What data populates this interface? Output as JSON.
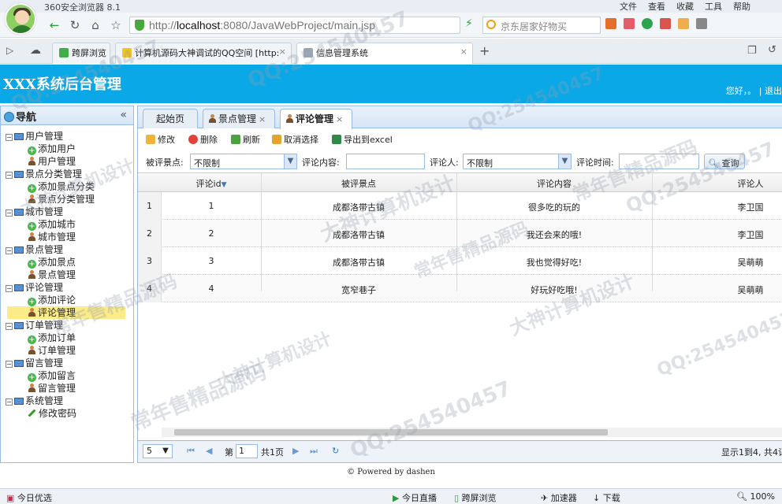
{
  "browser": {
    "title": "360安全浏览器 8.1",
    "menu": [
      "文件",
      "查看",
      "收藏",
      "工具",
      "帮助"
    ],
    "url_dim_prefix": "http://",
    "url_host": "localhost",
    "url_rest": ":8080/JavaWebProject/main.jsp",
    "search_placeholder": "京东居家好物买",
    "tabs": [
      {
        "label": "跨屏浏览"
      },
      {
        "label": "计算机源码大神调试的QQ空间 [http:"
      },
      {
        "label": "信息管理系统"
      }
    ]
  },
  "app": {
    "title": "XXX系统后台管理",
    "greeting": "您好，。 | 退出"
  },
  "nav": {
    "title": "导航",
    "collapse": "«",
    "groups": [
      {
        "label": "用户管理",
        "items": [
          "添加用户",
          "用户管理"
        ]
      },
      {
        "label": "景点分类管理",
        "items": [
          "添加景点分类",
          "景点分类管理"
        ]
      },
      {
        "label": "城市管理",
        "items": [
          "添加城市",
          "城市管理"
        ]
      },
      {
        "label": "景点管理",
        "items": [
          "添加景点",
          "景点管理"
        ]
      },
      {
        "label": "评论管理",
        "items": [
          "添加评论",
          "评论管理"
        ]
      },
      {
        "label": "订单管理",
        "items": [
          "添加订单",
          "订单管理"
        ]
      },
      {
        "label": "留言管理",
        "items": [
          "添加留言",
          "留言管理"
        ]
      },
      {
        "label": "系统管理",
        "items": [
          "修改密码"
        ]
      }
    ],
    "selected": "评论管理"
  },
  "content_tabs": [
    {
      "label": "起始页",
      "closable": false
    },
    {
      "label": "景点管理",
      "closable": true
    },
    {
      "label": "评论管理",
      "closable": true
    }
  ],
  "toolbar": {
    "edit": "修改",
    "delete": "删除",
    "refresh": "刷新",
    "cancel_select": "取消选择",
    "export": "导出到excel"
  },
  "filters": {
    "spot_label": "被评景点:",
    "spot_value": "不限制",
    "content_label": "评论内容:",
    "user_label": "评论人:",
    "user_value": "不限制",
    "time_label": "评论时间:",
    "query_button": "查询"
  },
  "grid": {
    "columns": [
      "评论id",
      "被评景点",
      "评论内容",
      "评论人"
    ],
    "sort_indicator": "▼",
    "rows": [
      {
        "rn": "1",
        "id": "1",
        "spot": "成都洛带古镇",
        "content": "很多吃的玩的",
        "user": "李卫国"
      },
      {
        "rn": "2",
        "id": "2",
        "spot": "成都洛带古镇",
        "content": "我还会来的哦!",
        "user": "李卫国"
      },
      {
        "rn": "3",
        "id": "3",
        "spot": "成都洛带古镇",
        "content": "我也觉得好吃!",
        "user": "吴萌萌"
      },
      {
        "rn": "4",
        "id": "4",
        "spot": "宽窄巷子",
        "content": "好玩好吃哦!",
        "user": "吴萌萌"
      }
    ]
  },
  "pager": {
    "page_size": "5",
    "page_label_pre": "第",
    "page_value": "1",
    "page_label_post": "共1页",
    "summary": "显示1到4, 共4记"
  },
  "footer": "© Powered by dashen",
  "status": {
    "left": "今日优选",
    "live": "今日直播",
    "cross": "跨屏浏览",
    "accel": "加速器",
    "download": "下载",
    "zoom": "100%"
  },
  "watermarks": [
    "QQ:254540457",
    "大神计算机设计",
    "常年售精品源码"
  ]
}
